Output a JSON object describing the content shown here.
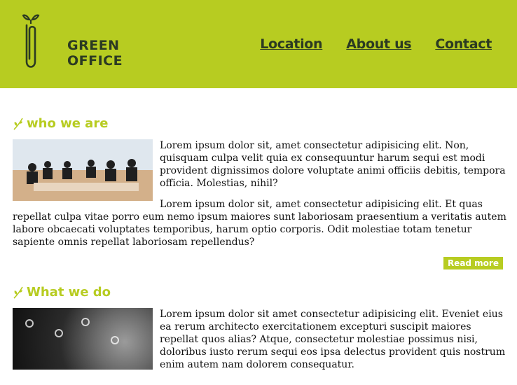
{
  "brand": {
    "name_line1": "GREEN",
    "name_line2": "OFFICE"
  },
  "nav": [
    {
      "label": "Location"
    },
    {
      "label": "About us"
    },
    {
      "label": "Contact"
    }
  ],
  "sections": [
    {
      "title": "who we are",
      "paragraphs": [
        "Lorem ipsum dolor sit, amet consectetur adipisicing elit. Non, quisquam culpa velit quia ex consequuntur harum sequi est modi provident dignissimos dolore voluptate animi officiis debitis, tempora officia. Molestias, nihil?",
        "Lorem ipsum dolor sit, amet consectetur adipisicing elit. Et quas repellat culpa vitae porro eum nemo ipsum maiores sunt laboriosam praesentium a veritatis autem labore obcaecati voluptates temporibus, harum optio corporis. Odit molestiae totam tenetur sapiente omnis repellat laboriosam repellendus?"
      ],
      "read_more": "Read more"
    },
    {
      "title": "What we do",
      "paragraphs": [
        "Lorem ipsum dolor sit amet consectetur adipisicing elit. Eveniet eius ea rerum architecto exercitationem excepturi suscipit maiores repellat quos alias? Atque, consectetur molestiae possimus nisi, doloribus iusto rerum sequi eos ipsa delectus provident quis nostrum enim autem nam dolorem consequatur."
      ]
    }
  ],
  "colors": {
    "accent": "#b7cc21",
    "dark": "#2b3a22"
  }
}
